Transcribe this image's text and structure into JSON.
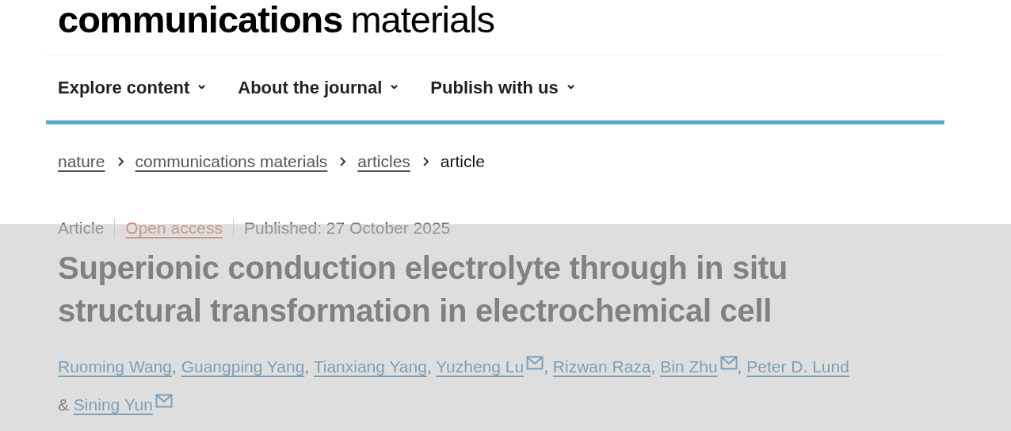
{
  "logo": {
    "bold": "communications",
    "light": "materials"
  },
  "nav": [
    {
      "label": "Explore content",
      "caret": "⌄"
    },
    {
      "label": "About the journal",
      "caret": "⌄"
    },
    {
      "label": "Publish with us",
      "caret": "⌄"
    }
  ],
  "breadcrumb": [
    {
      "label": "nature",
      "link": true
    },
    {
      "label": "communications materials",
      "link": true
    },
    {
      "label": "articles",
      "link": true
    },
    {
      "label": "article",
      "link": false
    }
  ],
  "meta": {
    "type": "Article",
    "access": "Open access",
    "published": "Published: 27 October 2025"
  },
  "title": "Superionic conduction electrolyte through in situ structural transformation in electrochemical cell",
  "authors": [
    {
      "name": "Ruoming Wang",
      "email": false,
      "trail": ","
    },
    {
      "name": "Guangping Yang",
      "email": false,
      "trail": ","
    },
    {
      "name": "Tianxiang Yang",
      "email": false,
      "trail": ","
    },
    {
      "name": "Yuzheng Lu",
      "email": true,
      "trail": ","
    },
    {
      "name": "Rizwan Raza",
      "email": false,
      "trail": ","
    },
    {
      "name": "Bin Zhu",
      "email": true,
      "trail": ","
    },
    {
      "name": "Peter D. Lund",
      "email": false
    },
    {
      "name": "Sining Yun",
      "email": true,
      "lead": "&"
    }
  ],
  "shade": {
    "kind": "overlay"
  }
}
